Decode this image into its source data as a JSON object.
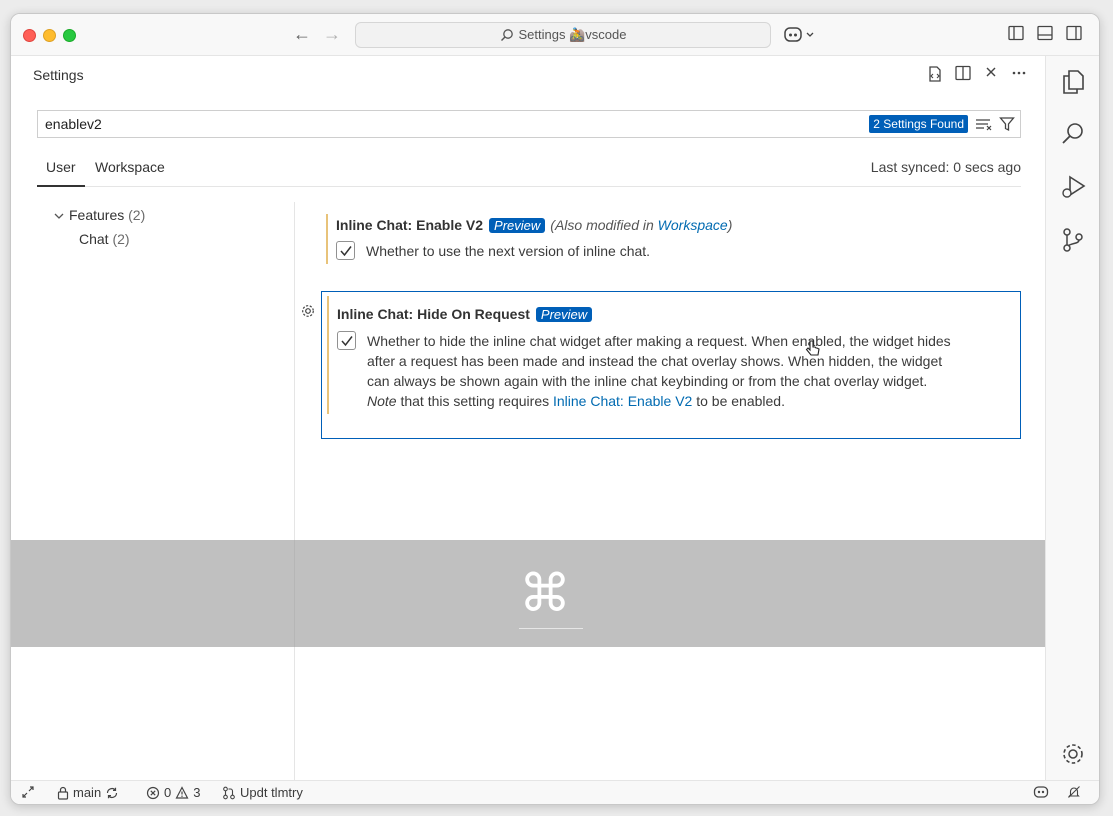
{
  "titlebar": {
    "command_center": "Settings 🚵vscode"
  },
  "editor": {
    "title": "Settings"
  },
  "search": {
    "value": "enablev2",
    "result_badge": "2 Settings Found"
  },
  "tabs": {
    "user": "User",
    "workspace": "Workspace",
    "last_synced": "Last synced: 0 secs ago"
  },
  "toc": {
    "features_label": "Features",
    "features_count": "(2)",
    "chat_label": "Chat",
    "chat_count": "(2)"
  },
  "settings": [
    {
      "title": "Inline Chat: Enable V2",
      "badge": "Preview",
      "modified_prefix": "(Also modified in",
      "modified_link": "Workspace",
      "modified_suffix": ")",
      "checked": true,
      "description": "Whether to use the next version of inline chat."
    },
    {
      "title": "Inline Chat: Hide On Request",
      "badge": "Preview",
      "checked": true,
      "description_lines": [
        "Whether to hide the inline chat widget after making a request. When enabled, the widget hides",
        "after a request has been made and instead the chat overlay shows. When hidden, the widget",
        "can always be shown again with the inline chat keybinding or from the chat overlay widget."
      ],
      "note_label": "Note",
      "note_text_before": "that this setting requires",
      "note_link": "Inline Chat: Enable V2",
      "note_text_after": "to be enabled."
    }
  ],
  "overlay": {
    "glyph": "⌘"
  },
  "statusbar": {
    "branch": "main",
    "errors": "0",
    "warnings": "3",
    "task": "Updt tlmtry"
  },
  "colors": {
    "accent": "#005fb8",
    "modified_bar": "#e8c37a",
    "link": "#006ab1"
  }
}
